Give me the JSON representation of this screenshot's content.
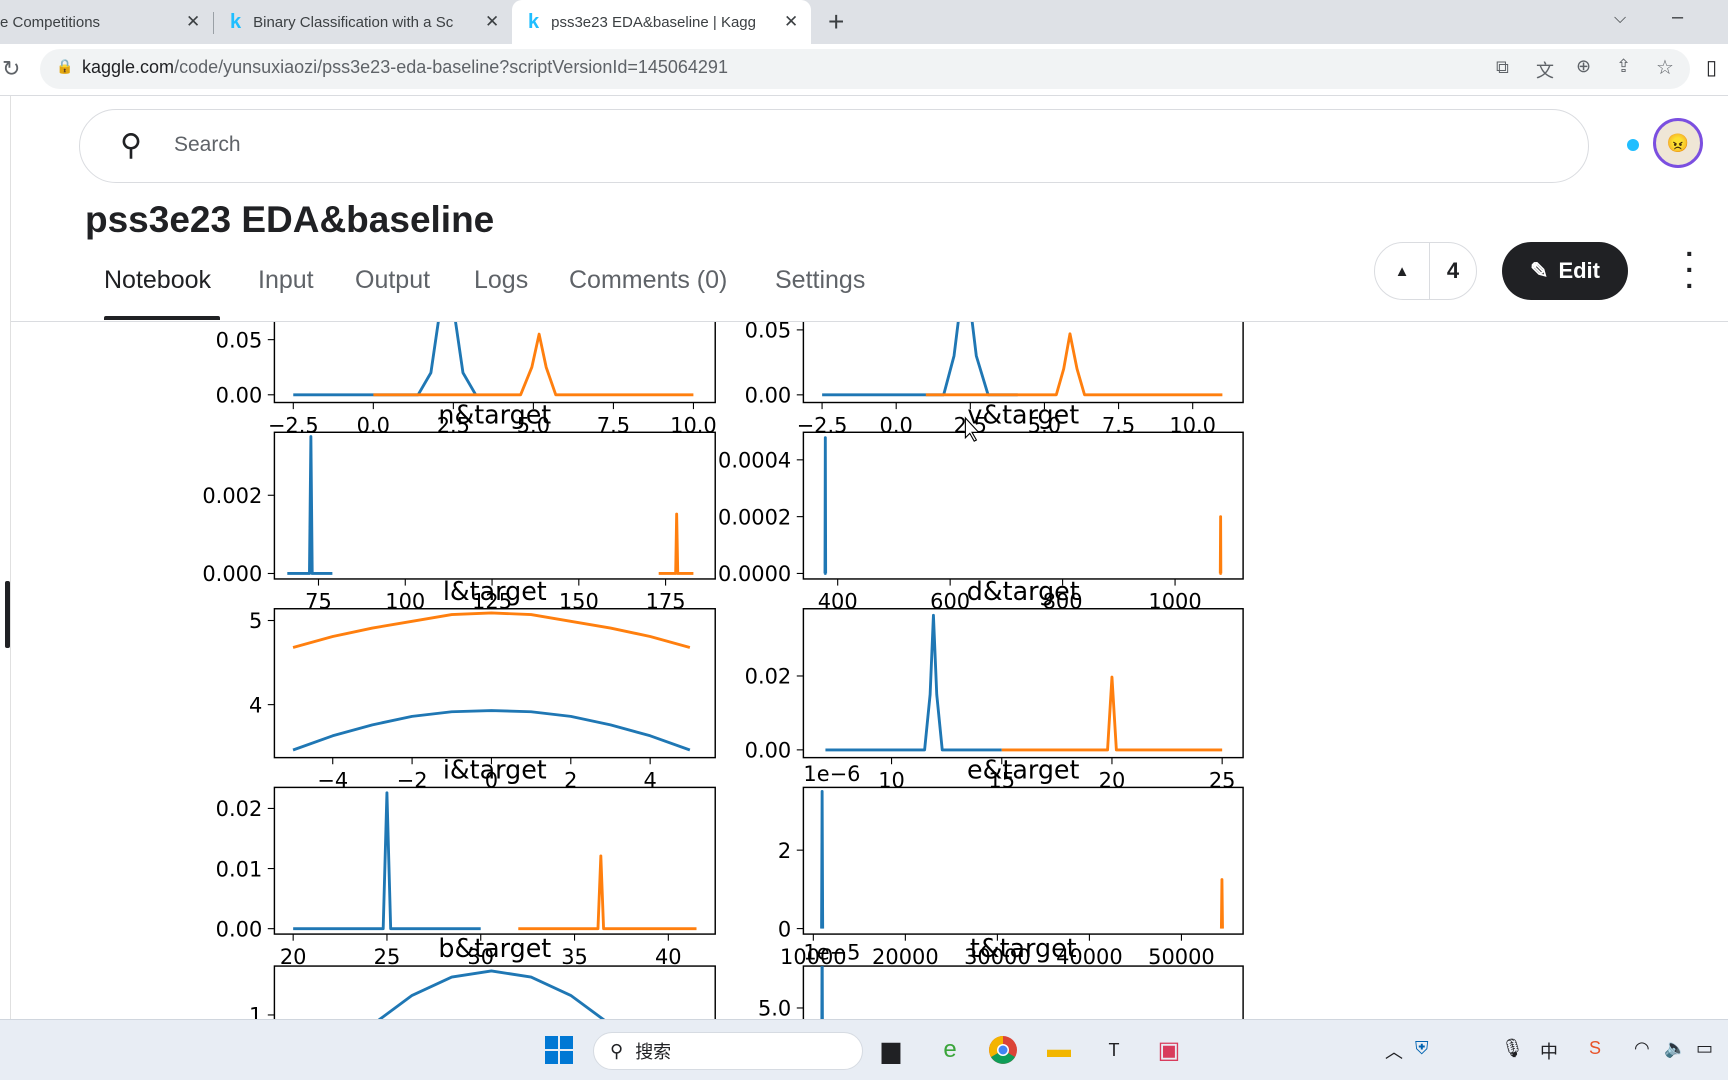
{
  "browser": {
    "tabs": [
      {
        "title": "e Competitions",
        "active": false
      },
      {
        "title": "Binary Classification with a Sc",
        "active": false
      },
      {
        "title": "pss3e23 EDA&baseline | Kagg",
        "active": true
      }
    ],
    "tab_close": "✕",
    "new_tab": "+",
    "url_host": "kaggle.com",
    "url_path": "/code/yunsuxiaozi/pss3e23-eda-baseline?scriptVersionId=145064291"
  },
  "header": {
    "search_placeholder": "Search",
    "notification_dot_color": "#20beff"
  },
  "notebook": {
    "title": "pss3e23 EDA&baseline",
    "tabs": [
      {
        "label": "Notebook",
        "active": true
      },
      {
        "label": "Input"
      },
      {
        "label": "Output"
      },
      {
        "label": "Logs"
      },
      {
        "label": "Comments (0)"
      },
      {
        "label": "Settings"
      }
    ],
    "vote_count": "4",
    "edit_label": "Edit"
  },
  "taskbar": {
    "search_label": "搜索"
  },
  "chart_data": [
    {
      "type": "line",
      "title": "",
      "xlim": [
        -3.09,
        10.68
      ],
      "ylim": [
        -0.007,
        0.126
      ],
      "xticks": [
        -2.5,
        0.0,
        2.5,
        5.0,
        7.5,
        10.0
      ],
      "xtick_labels": [
        "−2.5",
        "0.0",
        "2.5",
        "5.0",
        "7.5",
        "10.0"
      ],
      "yticks": [
        0.0,
        0.05
      ],
      "ytick_labels": [
        "0.00",
        "0.05"
      ],
      "series": [
        {
          "color": "#1f77b4",
          "points": [
            [
              -2.5,
              0
            ],
            [
              1.4,
              0
            ],
            [
              1.8,
              0.02
            ],
            [
              2.05,
              0.07
            ],
            [
              2.3,
              0.12
            ],
            [
              2.55,
              0.07
            ],
            [
              2.8,
              0.02
            ],
            [
              3.2,
              0
            ]
          ]
        },
        {
          "color": "#ff7f0e",
          "points": [
            [
              0,
              0
            ],
            [
              4.6,
              0
            ],
            [
              4.95,
              0.025
            ],
            [
              5.18,
              0.055
            ],
            [
              5.4,
              0.025
            ],
            [
              5.7,
              0
            ],
            [
              10,
              0
            ]
          ]
        }
      ]
    },
    {
      "type": "line",
      "title": "",
      "xlim": [
        -3.13,
        11.7
      ],
      "ylim": [
        -0.0059,
        0.107
      ],
      "xticks": [
        -2.5,
        0.0,
        2.5,
        5.0,
        7.5,
        10.0
      ],
      "xtick_labels": [
        "−2.5",
        "0.0",
        "2.5",
        "5.0",
        "7.5",
        "10.0"
      ],
      "yticks": [
        0.0,
        0.05
      ],
      "ytick_labels": [
        "0.00",
        "0.05"
      ],
      "series": [
        {
          "color": "#1f77b4",
          "points": [
            [
              -2.5,
              0
            ],
            [
              1.6,
              0
            ],
            [
              1.95,
              0.03
            ],
            [
              2.33,
              0.1
            ],
            [
              2.7,
              0.03
            ],
            [
              3.1,
              0
            ],
            [
              4.1,
              0
            ]
          ]
        },
        {
          "color": "#ff7f0e",
          "points": [
            [
              1.0,
              0
            ],
            [
              5.4,
              0
            ],
            [
              5.65,
              0.02
            ],
            [
              5.86,
              0.047
            ],
            [
              6.1,
              0.02
            ],
            [
              6.35,
              0
            ],
            [
              11,
              0
            ]
          ]
        }
      ]
    },
    {
      "type": "line",
      "title": "n&target",
      "xlim": [
        62.3,
        189.3
      ],
      "ylim": [
        -0.00014,
        0.00361
      ],
      "xticks": [
        75,
        100,
        125,
        150,
        175
      ],
      "xtick_labels": [
        "75",
        "100",
        "125",
        "150",
        "175"
      ],
      "yticks": [
        0.0,
        0.002
      ],
      "ytick_labels": [
        "0.000",
        "0.002"
      ],
      "series": [
        {
          "color": "#1f77b4",
          "points": [
            [
              66,
              0
            ],
            [
              72.4,
              0
            ],
            [
              72.8,
              0.0035
            ],
            [
              73.2,
              0
            ],
            [
              79,
              0
            ]
          ]
        },
        {
          "color": "#ff7f0e",
          "points": [
            [
              173,
              0
            ],
            [
              177.9,
              0
            ],
            [
              178.2,
              0.00152
            ],
            [
              178.5,
              0
            ],
            [
              183,
              0
            ]
          ]
        }
      ]
    },
    {
      "type": "line",
      "title": "v&target",
      "xlim": [
        339,
        1121
      ],
      "ylim": [
        -1.94e-05,
        0.000497
      ],
      "xticks": [
        400,
        600,
        800,
        1000
      ],
      "xtick_labels": [
        "400",
        "600",
        "800",
        "1000"
      ],
      "yticks": [
        0.0,
        0.0002,
        0.0004
      ],
      "ytick_labels": [
        "0.0000",
        "0.0002",
        "0.0004"
      ],
      "series": [
        {
          "color": "#1f77b4",
          "points": [
            [
              376,
              0
            ],
            [
              377.5,
              0
            ],
            [
              378,
              0.000478
            ],
            [
              378.5,
              0
            ],
            [
              380,
              0
            ]
          ]
        },
        {
          "color": "#ff7f0e",
          "points": [
            [
              1079,
              0
            ],
            [
              1080.5,
              0
            ],
            [
              1081,
              0.0002
            ],
            [
              1081.5,
              0
            ],
            [
              1083,
              0
            ]
          ]
        }
      ]
    },
    {
      "type": "line",
      "title": "l&target",
      "xlim": [
        -5.47,
        5.64
      ],
      "ylim": [
        3.37,
        5.14
      ],
      "xticks": [
        -4,
        -2,
        0,
        2,
        4
      ],
      "xtick_labels": [
        "−4",
        "−2",
        "0",
        "2",
        "4"
      ],
      "yticks": [
        4,
        5
      ],
      "ytick_labels": [
        "4",
        "5"
      ],
      "series": [
        {
          "color": "#1f77b4",
          "points": [
            [
              -5,
              3.46
            ],
            [
              -4,
              3.63
            ],
            [
              -3,
              3.76
            ],
            [
              -2,
              3.86
            ],
            [
              -1,
              3.915
            ],
            [
              0,
              3.93
            ],
            [
              1,
              3.915
            ],
            [
              2,
              3.86
            ],
            [
              3,
              3.76
            ],
            [
              4,
              3.63
            ],
            [
              5,
              3.46
            ]
          ]
        },
        {
          "color": "#ff7f0e",
          "points": [
            [
              -5,
              4.68
            ],
            [
              -4,
              4.81
            ],
            [
              -3,
              4.91
            ],
            [
              -2,
              4.99
            ],
            [
              -1,
              5.07
            ],
            [
              0,
              5.09
            ],
            [
              1,
              5.07
            ],
            [
              2,
              4.99
            ],
            [
              3,
              4.91
            ],
            [
              4,
              4.81
            ],
            [
              5,
              4.68
            ]
          ]
        }
      ]
    },
    {
      "type": "line",
      "title": "d&target",
      "xlim": [
        6.0,
        25.95
      ],
      "ylim": [
        -0.0021,
        0.0382
      ],
      "xticks": [
        10,
        15,
        20,
        25
      ],
      "xtick_labels": [
        "10",
        "15",
        "20",
        "25"
      ],
      "yticks": [
        0.0,
        0.02
      ],
      "ytick_labels": [
        "0.00",
        "0.02"
      ],
      "series": [
        {
          "color": "#1f77b4",
          "points": [
            [
              7,
              0
            ],
            [
              11.5,
              0
            ],
            [
              11.75,
              0.015
            ],
            [
              11.9,
              0.0364
            ],
            [
              12.05,
              0.015
            ],
            [
              12.3,
              0
            ],
            [
              15,
              0
            ]
          ]
        },
        {
          "color": "#ff7f0e",
          "points": [
            [
              15,
              0
            ],
            [
              19.8,
              0
            ],
            [
              20.0,
              0.0197
            ],
            [
              20.2,
              0
            ],
            [
              25,
              0
            ]
          ]
        }
      ]
    },
    {
      "type": "line",
      "title": "i&target",
      "xlim": [
        19.0,
        42.5
      ],
      "ylim": [
        -0.0009,
        0.0235
      ],
      "xticks": [
        20,
        25,
        30,
        35,
        40
      ],
      "xtick_labels": [
        "20",
        "25",
        "30",
        "35",
        "40"
      ],
      "yticks": [
        0.0,
        0.01,
        0.02
      ],
      "ytick_labels": [
        "0.00",
        "0.01",
        "0.02"
      ],
      "series": [
        {
          "color": "#1f77b4",
          "points": [
            [
              20,
              0
            ],
            [
              24.8,
              0
            ],
            [
              25,
              0.0226
            ],
            [
              25.2,
              0
            ],
            [
              30,
              0
            ]
          ]
        },
        {
          "color": "#ff7f0e",
          "points": [
            [
              32,
              0
            ],
            [
              36.25,
              0
            ],
            [
              36.4,
              0.0121
            ],
            [
              36.55,
              0
            ],
            [
              41.5,
              0
            ]
          ]
        }
      ]
    },
    {
      "type": "line",
      "title": "e&target",
      "offset_text": "1e−6",
      "xlim": [
        8920,
        56700
      ],
      "ylim": [
        -0.14,
        3.6
      ],
      "xticks": [
        10000,
        20000,
        30000,
        40000,
        50000
      ],
      "xtick_labels": [
        "10000",
        "20000",
        "30000",
        "40000",
        "50000"
      ],
      "yticks": [
        0,
        2
      ],
      "ytick_labels": [
        "0",
        "2"
      ],
      "series": [
        {
          "color": "#1f77b4",
          "points": [
            [
              10900,
              0
            ],
            [
              10960,
              3.5
            ],
            [
              11020,
              0
            ]
          ]
        },
        {
          "color": "#ff7f0e",
          "points": [
            [
              54340,
              0
            ],
            [
              54400,
              1.25
            ],
            [
              54460,
              0
            ]
          ]
        }
      ]
    },
    {
      "type": "line",
      "title": "b&target",
      "xlim": [
        -5.47,
        5.64
      ],
      "ylim": [
        0.6,
        1.2
      ],
      "xticks": [],
      "xtick_labels": [],
      "yticks": [
        1
      ],
      "ytick_labels": [
        "1"
      ],
      "series": [
        {
          "color": "#1f77b4",
          "points": [
            [
              -5,
              0.55
            ],
            [
              -4,
              0.78
            ],
            [
              -3,
              0.96
            ],
            [
              -2,
              1.08
            ],
            [
              -1,
              1.155
            ],
            [
              0,
              1.18
            ],
            [
              1,
              1.155
            ],
            [
              2,
              1.08
            ],
            [
              3,
              0.96
            ],
            [
              4,
              0.78
            ],
            [
              5,
              0.55
            ]
          ]
        }
      ]
    },
    {
      "type": "line",
      "title": "t&target",
      "offset_text": "1e−5",
      "xlim": [
        8920,
        56700
      ],
      "ylim": [
        0,
        7
      ],
      "xticks": [],
      "xtick_labels": [],
      "yticks": [
        5.0
      ],
      "ytick_labels": [
        "5.0"
      ],
      "series": [
        {
          "color": "#1f77b4",
          "points": [
            [
              10900,
              0
            ],
            [
              10960,
              9
            ],
            [
              11020,
              0
            ]
          ]
        }
      ]
    }
  ]
}
